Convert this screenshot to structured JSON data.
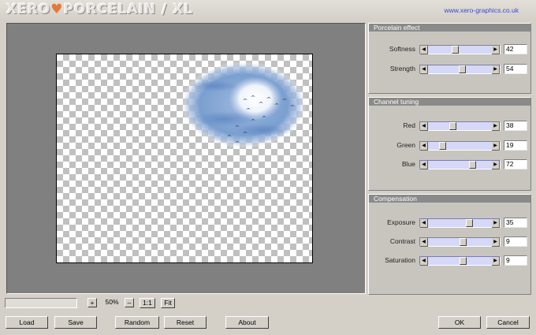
{
  "header": {
    "logo_left": "XERO",
    "logo_heart": "♥",
    "logo_right": "PORCELAIN / XL",
    "website": "www.xero-graphics.co.uk"
  },
  "panels": [
    {
      "title": "Porcelain effect",
      "controls": [
        {
          "label": "Softness",
          "value": "42"
        },
        {
          "label": "Strength",
          "value": "54"
        }
      ]
    },
    {
      "title": "Channel tuning",
      "controls": [
        {
          "label": "Red",
          "value": "38"
        },
        {
          "label": "Green",
          "value": "19"
        },
        {
          "label": "Blue",
          "value": "72"
        }
      ]
    },
    {
      "title": "Compensation",
      "controls": [
        {
          "label": "Exposure",
          "value": "35"
        },
        {
          "label": "Contrast",
          "value": "9"
        },
        {
          "label": "Saturation",
          "value": "9"
        }
      ]
    }
  ],
  "zoom": {
    "plus": "+",
    "value": "50%",
    "minus": "–",
    "one_to_one": "1:1",
    "fit": "Fit"
  },
  "buttons": {
    "load": "Load",
    "save": "Save",
    "random": "Random",
    "reset": "Reset",
    "about": "About",
    "ok": "OK",
    "cancel": "Cancel"
  },
  "slider_positions": {
    "softness": 0.42,
    "strength": 0.54,
    "red": 0.38,
    "green": 0.19,
    "blue": 0.72,
    "exposure": 0.67,
    "contrast": 0.55,
    "saturation": 0.55
  },
  "colors": {
    "panel_title_bg": "#8a8a8a",
    "slider_track": "#d6d8f8",
    "link": "#3a4cc8",
    "logo_heart": "#e27a38"
  }
}
